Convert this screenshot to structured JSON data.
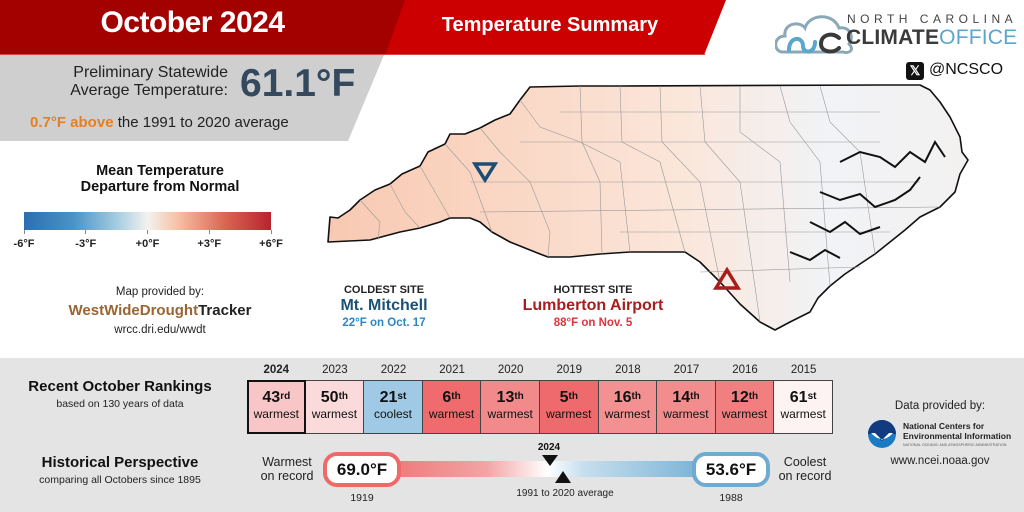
{
  "header": {
    "title": "October 2024",
    "subtitle": "Temperature Summary"
  },
  "colors": {
    "header_dark_red": "#a30000",
    "header_bright_red": "#cc0000",
    "avg_value": "#34495e",
    "above_highlight": "#e67e22",
    "coldest": "#1a5276",
    "hottest": "#a61e1e",
    "bottom_bg": "#e4e4e4"
  },
  "average": {
    "label_line1": "Preliminary Statewide",
    "label_line2": "Average Temperature:",
    "value": "61.1°F",
    "diff_highlight": "0.7°F above",
    "diff_rest": " the 1991 to 2020 average"
  },
  "logo": {
    "top": "NORTH CAROLINA",
    "bold": "CLIMATE",
    "light": "OFFICE",
    "x_icon": "𝕏",
    "handle": "@NCSCO"
  },
  "legend": {
    "title_line1": "Mean Temperature",
    "title_line2": "Departure from Normal",
    "ticks": [
      "-6°F",
      "-3°F",
      "+0°F",
      "+3°F",
      "+6°F"
    ],
    "range_f": [
      -6,
      6
    ]
  },
  "map_credit": {
    "label": "Map provided by:",
    "brand_colored": "WestWideDrought",
    "brand_dark": "Tracker",
    "url": "wrcc.dri.edu/wwdt"
  },
  "sites": {
    "coldest": {
      "heading": "COLDEST SITE",
      "name": "Mt. Mitchell",
      "detail": "22°F on Oct. 17",
      "marker": "triangle-down-icon"
    },
    "hottest": {
      "heading": "HOTTEST SITE",
      "name": "Lumberton Airport",
      "detail": "88°F on Nov. 5",
      "marker": "triangle-up-icon"
    }
  },
  "rankings": {
    "title": "Recent October Rankings",
    "subtitle": "based on 130 years of data",
    "items": [
      {
        "year": "2024",
        "rank": "43",
        "suffix": "rd",
        "desc": "warmest",
        "color": "#f8c6c6",
        "current": true
      },
      {
        "year": "2023",
        "rank": "50",
        "suffix": "th",
        "desc": "warmest",
        "color": "#fbdadb"
      },
      {
        "year": "2022",
        "rank": "21",
        "suffix": "st",
        "desc": "coolest",
        "color": "#9fc9e4"
      },
      {
        "year": "2021",
        "rank": "6",
        "suffix": "th",
        "desc": "warmest",
        "color": "#ef6b6d"
      },
      {
        "year": "2020",
        "rank": "13",
        "suffix": "th",
        "desc": "warmest",
        "color": "#f28a8b"
      },
      {
        "year": "2019",
        "rank": "5",
        "suffix": "th",
        "desc": "warmest",
        "color": "#ee6a6c"
      },
      {
        "year": "2018",
        "rank": "16",
        "suffix": "th",
        "desc": "warmest",
        "color": "#f39192"
      },
      {
        "year": "2017",
        "rank": "14",
        "suffix": "th",
        "desc": "warmest",
        "color": "#f28c8d"
      },
      {
        "year": "2016",
        "rank": "12",
        "suffix": "th",
        "desc": "warmest",
        "color": "#f17f80"
      },
      {
        "year": "2015",
        "rank": "61",
        "suffix": "st",
        "desc": "warmest",
        "color": "#fdf3f3"
      }
    ]
  },
  "history": {
    "title": "Historical Perspective",
    "subtitle": "comparing all Octobers since 1895",
    "warmest_label_1": "Warmest",
    "warmest_label_2": "on record",
    "warmest_value": "69.0°F",
    "warmest_year": "1919",
    "coolest_label_1": "Coolest",
    "coolest_label_2": "on record",
    "coolest_value": "53.6°F",
    "coolest_year": "1988",
    "current_label": "2024",
    "average_label": "1991 to 2020 average"
  },
  "data_credit": {
    "label": "Data provided by:",
    "org_line1": "National Centers for",
    "org_line2": "Environmental Information",
    "org_sub": "NATIONAL OCEANIC AND ATMOSPHERIC ADMINISTRATION",
    "url": "www.ncei.noaa.gov"
  }
}
